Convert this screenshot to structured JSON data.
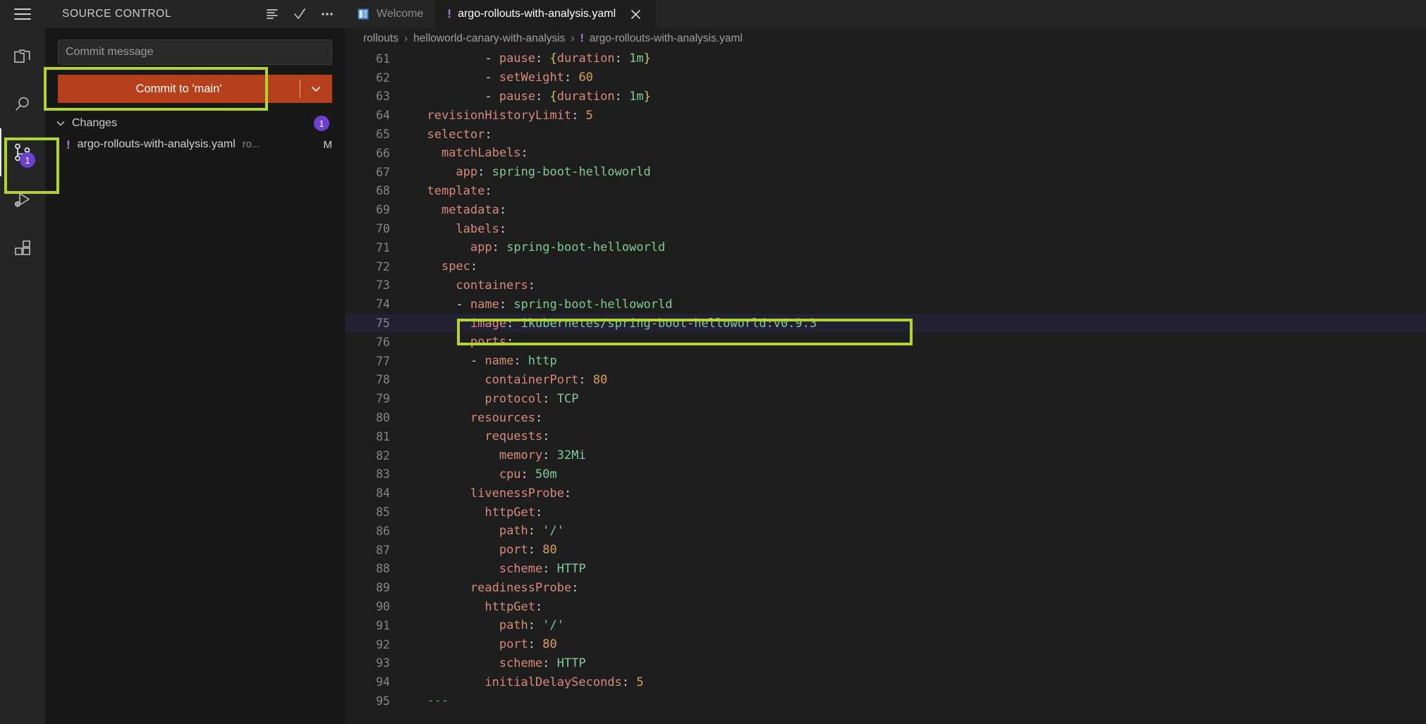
{
  "window": {
    "menu_icon": "hamburger-menu-icon"
  },
  "source_control": {
    "title": "SOURCE CONTROL",
    "actions": [
      {
        "name": "view-as-list-icon",
        "tooltip": "View as Tree"
      },
      {
        "name": "commit-check-icon",
        "tooltip": "Commit"
      },
      {
        "name": "more-actions-icon",
        "tooltip": "Views and More Actions..."
      }
    ],
    "commit_message_placeholder": "Commit message",
    "commit_message_value": "",
    "commit_button_label": "Commit to 'main'",
    "commit_dropdown_icon": "chevron-down-icon",
    "changes_section": {
      "label": "Changes",
      "count": "1",
      "chevron": "chevron-down-icon"
    },
    "files": [
      {
        "status_icon": "warning-exclamation-icon",
        "name": "argo-rollouts-with-analysis.yaml",
        "folder": "ro...",
        "status": "M"
      }
    ]
  },
  "activity_bar": {
    "items": [
      {
        "name": "explorer-icon",
        "label": "Explorer",
        "active": false,
        "badge": ""
      },
      {
        "name": "search-icon",
        "label": "Search",
        "active": false,
        "badge": ""
      },
      {
        "name": "source-control-icon",
        "label": "Source Control",
        "active": true,
        "badge": "1"
      },
      {
        "name": "run-and-debug-icon",
        "label": "Run and Debug",
        "active": false,
        "badge": ""
      },
      {
        "name": "extensions-icon",
        "label": "Extensions",
        "active": false,
        "badge": ""
      }
    ]
  },
  "tabs": [
    {
      "name": "tab-welcome",
      "label": "Welcome",
      "icon": "welcome-page-icon",
      "active": false,
      "dirty": false,
      "closable": false
    },
    {
      "name": "tab-argo-rollouts-yaml",
      "label": "argo-rollouts-with-analysis.yaml",
      "icon": "warning-exclamation-icon",
      "active": true,
      "dirty": false,
      "closable": true,
      "close_icon": "close-icon"
    }
  ],
  "breadcrumbs": [
    {
      "label": "rollouts",
      "icon": ""
    },
    {
      "label": "helloworld-canary-with-analysis",
      "icon": ""
    },
    {
      "label": "argo-rollouts-with-analysis.yaml",
      "icon": "warning-exclamation-icon"
    }
  ],
  "editor": {
    "language": "yaml",
    "first_visible_line": 61,
    "highlighted_line": 75,
    "lines": [
      {
        "no": "61",
        "modified": false,
        "highlighted": false,
        "tokens": [
          {
            "t": "          - ",
            "c": "p"
          },
          {
            "t": "pause",
            "c": "k"
          },
          {
            "t": ": ",
            "c": "p"
          },
          {
            "t": "{",
            "c": "b"
          },
          {
            "t": "duration",
            "c": "k"
          },
          {
            "t": ": ",
            "c": "p"
          },
          {
            "t": "1m",
            "c": "s"
          },
          {
            "t": "}",
            "c": "b"
          }
        ]
      },
      {
        "no": "62",
        "modified": false,
        "highlighted": false,
        "tokens": [
          {
            "t": "          - ",
            "c": "p"
          },
          {
            "t": "setWeight",
            "c": "k"
          },
          {
            "t": ": ",
            "c": "p"
          },
          {
            "t": "60",
            "c": "n"
          }
        ]
      },
      {
        "no": "63",
        "modified": false,
        "highlighted": false,
        "tokens": [
          {
            "t": "          - ",
            "c": "p"
          },
          {
            "t": "pause",
            "c": "k"
          },
          {
            "t": ": ",
            "c": "p"
          },
          {
            "t": "{",
            "c": "b"
          },
          {
            "t": "duration",
            "c": "k"
          },
          {
            "t": ": ",
            "c": "p"
          },
          {
            "t": "1m",
            "c": "s"
          },
          {
            "t": "}",
            "c": "b"
          }
        ]
      },
      {
        "no": "64",
        "modified": false,
        "highlighted": false,
        "tokens": [
          {
            "t": "  ",
            "c": "p"
          },
          {
            "t": "revisionHistoryLimit",
            "c": "k"
          },
          {
            "t": ": ",
            "c": "p"
          },
          {
            "t": "5",
            "c": "n"
          }
        ]
      },
      {
        "no": "65",
        "modified": false,
        "highlighted": false,
        "tokens": [
          {
            "t": "  ",
            "c": "p"
          },
          {
            "t": "selector",
            "c": "k"
          },
          {
            "t": ":",
            "c": "p"
          }
        ]
      },
      {
        "no": "66",
        "modified": false,
        "highlighted": false,
        "tokens": [
          {
            "t": "    ",
            "c": "p"
          },
          {
            "t": "matchLabels",
            "c": "k"
          },
          {
            "t": ":",
            "c": "p"
          }
        ]
      },
      {
        "no": "67",
        "modified": false,
        "highlighted": false,
        "tokens": [
          {
            "t": "      ",
            "c": "p"
          },
          {
            "t": "app",
            "c": "k"
          },
          {
            "t": ": ",
            "c": "p"
          },
          {
            "t": "spring-boot-helloworld",
            "c": "s"
          }
        ]
      },
      {
        "no": "68",
        "modified": false,
        "highlighted": false,
        "tokens": [
          {
            "t": "  ",
            "c": "p"
          },
          {
            "t": "template",
            "c": "k"
          },
          {
            "t": ":",
            "c": "p"
          }
        ]
      },
      {
        "no": "69",
        "modified": false,
        "highlighted": false,
        "tokens": [
          {
            "t": "    ",
            "c": "p"
          },
          {
            "t": "metadata",
            "c": "k"
          },
          {
            "t": ":",
            "c": "p"
          }
        ]
      },
      {
        "no": "70",
        "modified": false,
        "highlighted": false,
        "tokens": [
          {
            "t": "      ",
            "c": "p"
          },
          {
            "t": "labels",
            "c": "k"
          },
          {
            "t": ":",
            "c": "p"
          }
        ]
      },
      {
        "no": "71",
        "modified": false,
        "highlighted": false,
        "tokens": [
          {
            "t": "        ",
            "c": "p"
          },
          {
            "t": "app",
            "c": "k"
          },
          {
            "t": ": ",
            "c": "p"
          },
          {
            "t": "spring-boot-helloworld",
            "c": "s"
          }
        ]
      },
      {
        "no": "72",
        "modified": false,
        "highlighted": false,
        "tokens": [
          {
            "t": "    ",
            "c": "p"
          },
          {
            "t": "spec",
            "c": "k"
          },
          {
            "t": ":",
            "c": "p"
          }
        ]
      },
      {
        "no": "73",
        "modified": false,
        "highlighted": false,
        "tokens": [
          {
            "t": "      ",
            "c": "p"
          },
          {
            "t": "containers",
            "c": "k"
          },
          {
            "t": ":",
            "c": "p"
          }
        ]
      },
      {
        "no": "74",
        "modified": false,
        "highlighted": false,
        "tokens": [
          {
            "t": "      - ",
            "c": "p"
          },
          {
            "t": "name",
            "c": "k"
          },
          {
            "t": ": ",
            "c": "p"
          },
          {
            "t": "spring-boot-helloworld",
            "c": "s"
          }
        ]
      },
      {
        "no": "75",
        "modified": true,
        "highlighted": true,
        "tokens": [
          {
            "t": "        ",
            "c": "p"
          },
          {
            "t": "image",
            "c": "k"
          },
          {
            "t": ": ",
            "c": "p"
          },
          {
            "t": "ikubernetes/spring-boot-helloworld:v0.9.3",
            "c": "s"
          }
        ]
      },
      {
        "no": "76",
        "modified": false,
        "highlighted": false,
        "tokens": [
          {
            "t": "        ",
            "c": "p"
          },
          {
            "t": "ports",
            "c": "k"
          },
          {
            "t": ":",
            "c": "p"
          }
        ]
      },
      {
        "no": "77",
        "modified": false,
        "highlighted": false,
        "tokens": [
          {
            "t": "        - ",
            "c": "p"
          },
          {
            "t": "name",
            "c": "k"
          },
          {
            "t": ": ",
            "c": "p"
          },
          {
            "t": "http",
            "c": "s"
          }
        ]
      },
      {
        "no": "78",
        "modified": false,
        "highlighted": false,
        "tokens": [
          {
            "t": "          ",
            "c": "p"
          },
          {
            "t": "containerPort",
            "c": "k"
          },
          {
            "t": ": ",
            "c": "p"
          },
          {
            "t": "80",
            "c": "n"
          }
        ]
      },
      {
        "no": "79",
        "modified": false,
        "highlighted": false,
        "tokens": [
          {
            "t": "          ",
            "c": "p"
          },
          {
            "t": "protocol",
            "c": "k"
          },
          {
            "t": ": ",
            "c": "p"
          },
          {
            "t": "TCP",
            "c": "s"
          }
        ]
      },
      {
        "no": "80",
        "modified": false,
        "highlighted": false,
        "tokens": [
          {
            "t": "        ",
            "c": "p"
          },
          {
            "t": "resources",
            "c": "k"
          },
          {
            "t": ":",
            "c": "p"
          }
        ]
      },
      {
        "no": "81",
        "modified": false,
        "highlighted": false,
        "tokens": [
          {
            "t": "          ",
            "c": "p"
          },
          {
            "t": "requests",
            "c": "k"
          },
          {
            "t": ":",
            "c": "p"
          }
        ]
      },
      {
        "no": "82",
        "modified": false,
        "highlighted": false,
        "tokens": [
          {
            "t": "            ",
            "c": "p"
          },
          {
            "t": "memory",
            "c": "k"
          },
          {
            "t": ": ",
            "c": "p"
          },
          {
            "t": "32Mi",
            "c": "s"
          }
        ]
      },
      {
        "no": "83",
        "modified": false,
        "highlighted": false,
        "tokens": [
          {
            "t": "            ",
            "c": "p"
          },
          {
            "t": "cpu",
            "c": "k"
          },
          {
            "t": ": ",
            "c": "p"
          },
          {
            "t": "50m",
            "c": "s"
          }
        ]
      },
      {
        "no": "84",
        "modified": false,
        "highlighted": false,
        "tokens": [
          {
            "t": "        ",
            "c": "p"
          },
          {
            "t": "livenessProbe",
            "c": "k"
          },
          {
            "t": ":",
            "c": "p"
          }
        ]
      },
      {
        "no": "85",
        "modified": false,
        "highlighted": false,
        "tokens": [
          {
            "t": "          ",
            "c": "p"
          },
          {
            "t": "httpGet",
            "c": "k"
          },
          {
            "t": ":",
            "c": "p"
          }
        ]
      },
      {
        "no": "86",
        "modified": false,
        "highlighted": false,
        "tokens": [
          {
            "t": "            ",
            "c": "p"
          },
          {
            "t": "path",
            "c": "k"
          },
          {
            "t": ": ",
            "c": "p"
          },
          {
            "t": "'/'",
            "c": "s"
          }
        ]
      },
      {
        "no": "87",
        "modified": false,
        "highlighted": false,
        "tokens": [
          {
            "t": "            ",
            "c": "p"
          },
          {
            "t": "port",
            "c": "k"
          },
          {
            "t": ": ",
            "c": "p"
          },
          {
            "t": "80",
            "c": "n"
          }
        ]
      },
      {
        "no": "88",
        "modified": false,
        "highlighted": false,
        "tokens": [
          {
            "t": "            ",
            "c": "p"
          },
          {
            "t": "scheme",
            "c": "k"
          },
          {
            "t": ": ",
            "c": "p"
          },
          {
            "t": "HTTP",
            "c": "s"
          }
        ]
      },
      {
        "no": "89",
        "modified": false,
        "highlighted": false,
        "tokens": [
          {
            "t": "        ",
            "c": "p"
          },
          {
            "t": "readinessProbe",
            "c": "k"
          },
          {
            "t": ":",
            "c": "p"
          }
        ]
      },
      {
        "no": "90",
        "modified": false,
        "highlighted": false,
        "tokens": [
          {
            "t": "          ",
            "c": "p"
          },
          {
            "t": "httpGet",
            "c": "k"
          },
          {
            "t": ":",
            "c": "p"
          }
        ]
      },
      {
        "no": "91",
        "modified": false,
        "highlighted": false,
        "tokens": [
          {
            "t": "            ",
            "c": "p"
          },
          {
            "t": "path",
            "c": "k"
          },
          {
            "t": ": ",
            "c": "p"
          },
          {
            "t": "'/'",
            "c": "s"
          }
        ]
      },
      {
        "no": "92",
        "modified": false,
        "highlighted": false,
        "tokens": [
          {
            "t": "            ",
            "c": "p"
          },
          {
            "t": "port",
            "c": "k"
          },
          {
            "t": ": ",
            "c": "p"
          },
          {
            "t": "80",
            "c": "n"
          }
        ]
      },
      {
        "no": "93",
        "modified": false,
        "highlighted": false,
        "tokens": [
          {
            "t": "            ",
            "c": "p"
          },
          {
            "t": "scheme",
            "c": "k"
          },
          {
            "t": ": ",
            "c": "p"
          },
          {
            "t": "HTTP",
            "c": "s"
          }
        ]
      },
      {
        "no": "94",
        "modified": false,
        "highlighted": false,
        "tokens": [
          {
            "t": "          ",
            "c": "p"
          },
          {
            "t": "initialDelaySeconds",
            "c": "k"
          },
          {
            "t": ": ",
            "c": "p"
          },
          {
            "t": "5",
            "c": "n"
          }
        ]
      },
      {
        "no": "95",
        "modified": false,
        "highlighted": false,
        "tokens": [
          {
            "t": "  ",
            "c": "p"
          },
          {
            "t": "---",
            "c": "c"
          }
        ]
      }
    ]
  },
  "annotations": [
    {
      "name": "annotation-commit-button",
      "target": "commit-button"
    },
    {
      "name": "annotation-source-control-icon",
      "target": "activity-bar-source-control"
    },
    {
      "name": "annotation-image-line",
      "target": "editor-line-75"
    }
  ],
  "colors": {
    "annotation": "#b2d430",
    "commit_button": "#b5401b",
    "badge": "#6c3fd1",
    "editor_bg": "#1e1e1e",
    "sidebar_bg": "#181818",
    "chrome_bg": "#252526"
  }
}
